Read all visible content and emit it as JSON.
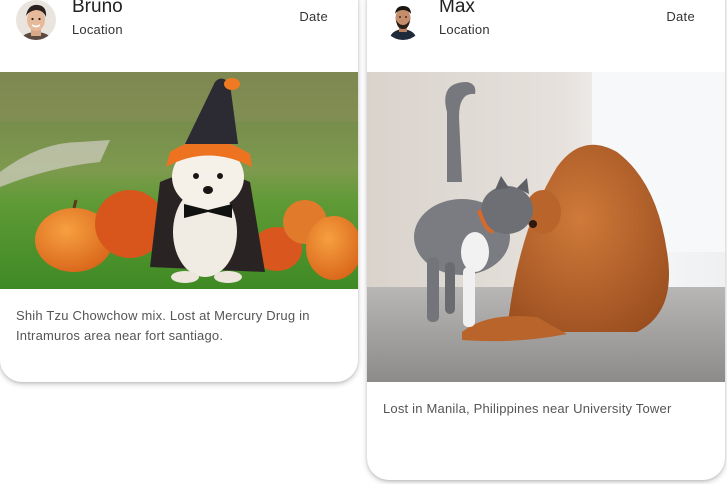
{
  "posts": [
    {
      "author": "Bruno",
      "location": "Location",
      "date": "Date",
      "caption": "Shih Tzu Chowchow mix. Lost at Mercury Drug in Intramuros area near fort santiago.",
      "photo_subject": "dog in halloween costume with pumpkins"
    },
    {
      "author": "Max",
      "location": "Location",
      "date": "Date",
      "caption": "Lost in Manila, Philippines near University Tower",
      "photo_subject": "gray cat and golden retriever"
    }
  ],
  "colors": {
    "card_background": "#ffffff",
    "name_text": "#222222",
    "caption_text": "#555555"
  }
}
